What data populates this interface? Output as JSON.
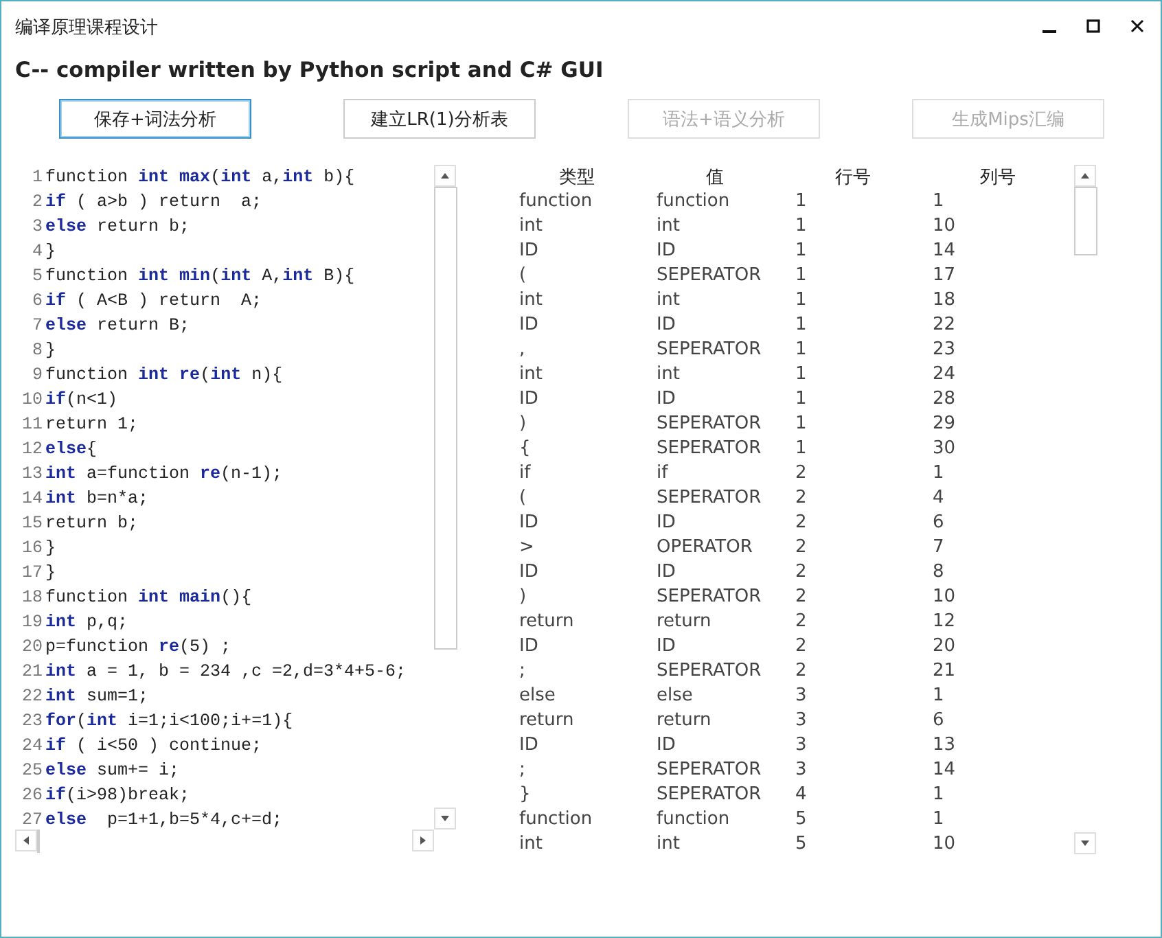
{
  "window": {
    "title": "编译原理课程设计"
  },
  "heading": "C-- compiler written by Python script and C# GUI",
  "buttons": [
    {
      "label": "保存+词法分析",
      "focused": true,
      "disabled": false
    },
    {
      "label": "建立LR(1)分析表",
      "focused": false,
      "disabled": false
    },
    {
      "label": "语法+语义分析",
      "focused": false,
      "disabled": true
    },
    {
      "label": "生成Mips汇编",
      "focused": false,
      "disabled": true
    }
  ],
  "editor": {
    "lines": [
      {
        "number": "1",
        "code": "function **int** **max**(**int** a,**int** b){"
      },
      {
        "number": "2",
        "code": "**if** ( a>b ) return  a;"
      },
      {
        "number": "3",
        "code": "**else** return b;"
      },
      {
        "number": "4",
        "code": "}"
      },
      {
        "number": "5",
        "code": "function **int** **min**(**int** A,**int** B){"
      },
      {
        "number": "6",
        "code": "**if** ( A<B ) return  A;"
      },
      {
        "number": "7",
        "code": "**else** return B;"
      },
      {
        "number": "8",
        "code": "}"
      },
      {
        "number": "9",
        "code": "function **int** **re**(**int** n){"
      },
      {
        "number": "10",
        "code": "**if**(n<1)"
      },
      {
        "number": "11",
        "code": "return 1;"
      },
      {
        "number": "12",
        "code": "**else**{"
      },
      {
        "number": "13",
        "code": "**int** a=function **re**(n-1);"
      },
      {
        "number": "14",
        "code": "**int** b=n*a;"
      },
      {
        "number": "15",
        "code": "return b;"
      },
      {
        "number": "16",
        "code": "}"
      },
      {
        "number": "17",
        "code": "}"
      },
      {
        "number": "18",
        "code": "function **int** **main**(){"
      },
      {
        "number": "19",
        "code": "**int** p,q;"
      },
      {
        "number": "20",
        "code": "p=function **re**(5) ;"
      },
      {
        "number": "21",
        "code": "**int** a = 1, b = 234 ,c =2,d=3*4+5-6;"
      },
      {
        "number": "22",
        "code": "**int** sum=1;"
      },
      {
        "number": "23",
        "code": "**for**(**int** i=1;i<100;i+=1){"
      },
      {
        "number": "24",
        "code": "**if** ( i<50 ) continue;"
      },
      {
        "number": "25",
        "code": "**else** sum+= i;"
      },
      {
        "number": "26",
        "code": "**if**(i>98)break;"
      },
      {
        "number": "27",
        "code": "**else**  p=1+1,b=5*4,c+=d;"
      }
    ]
  },
  "tokens": {
    "columns": [
      "类型",
      "值",
      "行号",
      "列号"
    ],
    "rows": [
      [
        "function",
        "function",
        "1",
        "1"
      ],
      [
        "int",
        "int",
        "1",
        "10"
      ],
      [
        "ID",
        "ID",
        "1",
        "14"
      ],
      [
        "(",
        "SEPERATOR",
        "1",
        "17"
      ],
      [
        "int",
        "int",
        "1",
        "18"
      ],
      [
        "ID",
        "ID",
        "1",
        "22"
      ],
      [
        ",",
        "SEPERATOR",
        "1",
        "23"
      ],
      [
        "int",
        "int",
        "1",
        "24"
      ],
      [
        "ID",
        "ID",
        "1",
        "28"
      ],
      [
        ")",
        "SEPERATOR",
        "1",
        "29"
      ],
      [
        "{",
        "SEPERATOR",
        "1",
        "30"
      ],
      [
        "if",
        "if",
        "2",
        "1"
      ],
      [
        "(",
        "SEPERATOR",
        "2",
        "4"
      ],
      [
        "ID",
        "ID",
        "2",
        "6"
      ],
      [
        ">",
        "OPERATOR",
        "2",
        "7"
      ],
      [
        "ID",
        "ID",
        "2",
        "8"
      ],
      [
        ")",
        "SEPERATOR",
        "2",
        "10"
      ],
      [
        "return",
        "return",
        "2",
        "12"
      ],
      [
        "ID",
        "ID",
        "2",
        "20"
      ],
      [
        ";",
        "SEPERATOR",
        "2",
        "21"
      ],
      [
        "else",
        "else",
        "3",
        "1"
      ],
      [
        "return",
        "return",
        "3",
        "6"
      ],
      [
        "ID",
        "ID",
        "3",
        "13"
      ],
      [
        ";",
        "SEPERATOR",
        "3",
        "14"
      ],
      [
        "}",
        "SEPERATOR",
        "4",
        "1"
      ],
      [
        "function",
        "function",
        "5",
        "1"
      ],
      [
        "int",
        "int",
        "5",
        "10"
      ]
    ]
  }
}
